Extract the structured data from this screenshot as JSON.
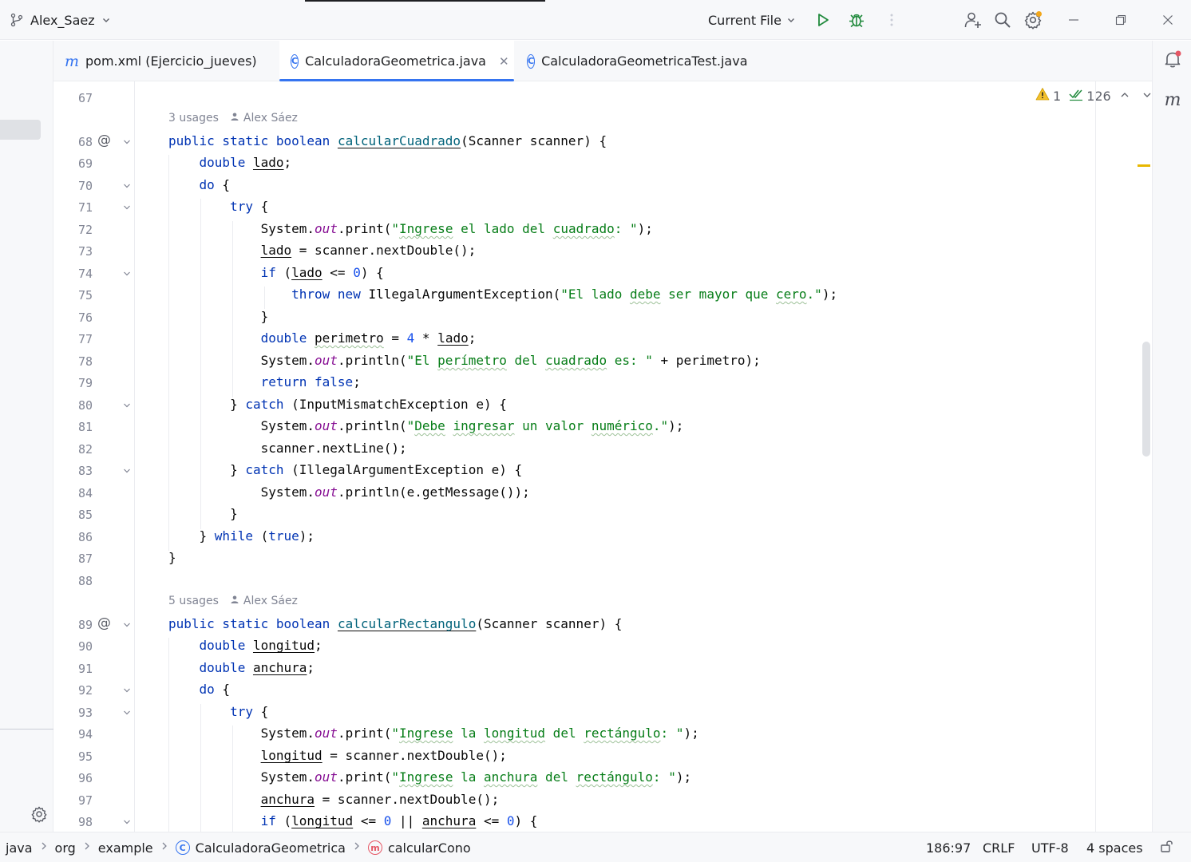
{
  "titlebar": {
    "project_name": "Alex_Saez",
    "run_config": "Current File"
  },
  "tabs": [
    {
      "label": "pom.xml (Ejercicio_jueves)",
      "icon": "maven-icon",
      "active": false
    },
    {
      "label": "CalculadoraGeometrica.java",
      "icon": "java-class-icon",
      "active": true
    },
    {
      "label": "CalculadoraGeometricaTest.java",
      "icon": "java-class-icon",
      "active": false
    }
  ],
  "inspections": {
    "warnings": "1",
    "checks": "126"
  },
  "line_numbers": [
    "67",
    "68",
    "69",
    "70",
    "71",
    "72",
    "73",
    "74",
    "75",
    "76",
    "77",
    "78",
    "79",
    "80",
    "81",
    "82",
    "83",
    "84",
    "85",
    "86",
    "87",
    "88",
    "89",
    "90",
    "91",
    "92",
    "93",
    "94",
    "95",
    "96",
    "97",
    "98"
  ],
  "usages": [
    {
      "count": "3 usages",
      "author": "Alex Sáez"
    },
    {
      "count": "5 usages",
      "author": "Alex Sáez"
    }
  ],
  "status": {
    "breadcrumbs": [
      "java",
      "org",
      "example",
      "CalculadoraGeometrica",
      "calcularCono"
    ],
    "position": "186:97",
    "line_separator": "CRLF",
    "encoding": "UTF-8",
    "indent": "4 spaces"
  },
  "colors": {
    "accent": "#3574f0",
    "keyword": "#0033b3",
    "string": "#067d17",
    "number": "#1750eb",
    "static_field": "#871094",
    "method_decl": "#00627a",
    "warning": "#e8b700"
  }
}
